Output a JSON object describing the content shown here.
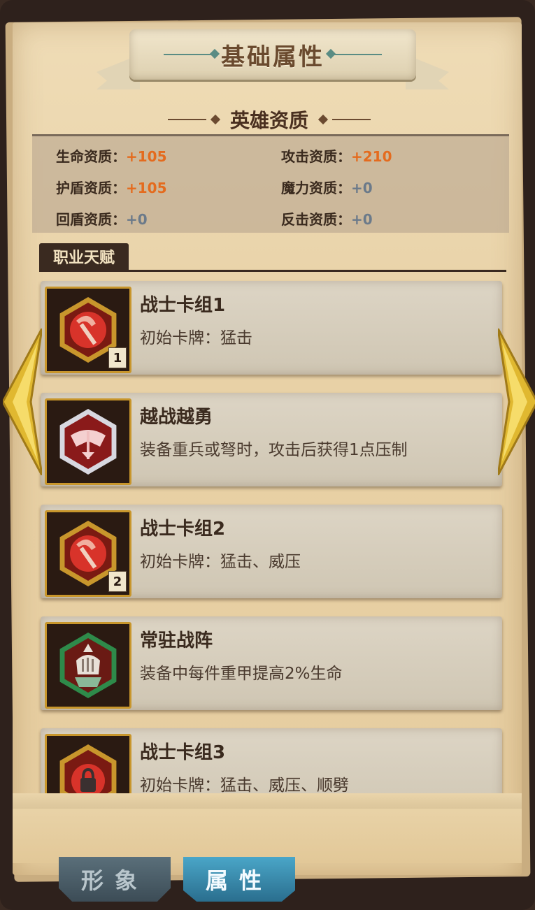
{
  "ribbon": {
    "title": "基础属性"
  },
  "aptitude": {
    "title": "英雄资质",
    "stats": [
      {
        "label": "生命资质：",
        "value": "+105"
      },
      {
        "label": "攻击资质：",
        "value": "+210"
      },
      {
        "label": "护盾资质：",
        "value": "+105"
      },
      {
        "label": "魔力资质：",
        "value": "+0"
      },
      {
        "label": "回盾资质：",
        "value": "+0"
      },
      {
        "label": "反击资质：",
        "value": "+0"
      }
    ]
  },
  "talent": {
    "header": "职业天赋",
    "cards": [
      {
        "title": "战士卡组1",
        "desc": "初始卡牌：猛击",
        "badge": "1",
        "icon": "axe-icon"
      },
      {
        "title": "越战越勇",
        "desc": "装备重兵或弩时，攻击后获得1点压制",
        "icon": "crossed-axes-icon"
      },
      {
        "title": "战士卡组2",
        "desc": "初始卡牌：猛击、威压",
        "badge": "2",
        "icon": "axe-icon"
      },
      {
        "title": "常驻战阵",
        "desc": "装备中每件重甲提高2%生命",
        "icon": "helmet-icon"
      },
      {
        "title": "战士卡组3",
        "desc": "初始卡牌：猛击、威压、顺劈",
        "icon": "locked-chain-icon"
      }
    ]
  },
  "tabs": [
    {
      "label": "形象",
      "active": false
    },
    {
      "label": "属性",
      "active": true
    }
  ],
  "colors": {
    "accent": "#e46b1e",
    "zero": "#6b7a8a",
    "tab_active": "#4aa6c8"
  }
}
